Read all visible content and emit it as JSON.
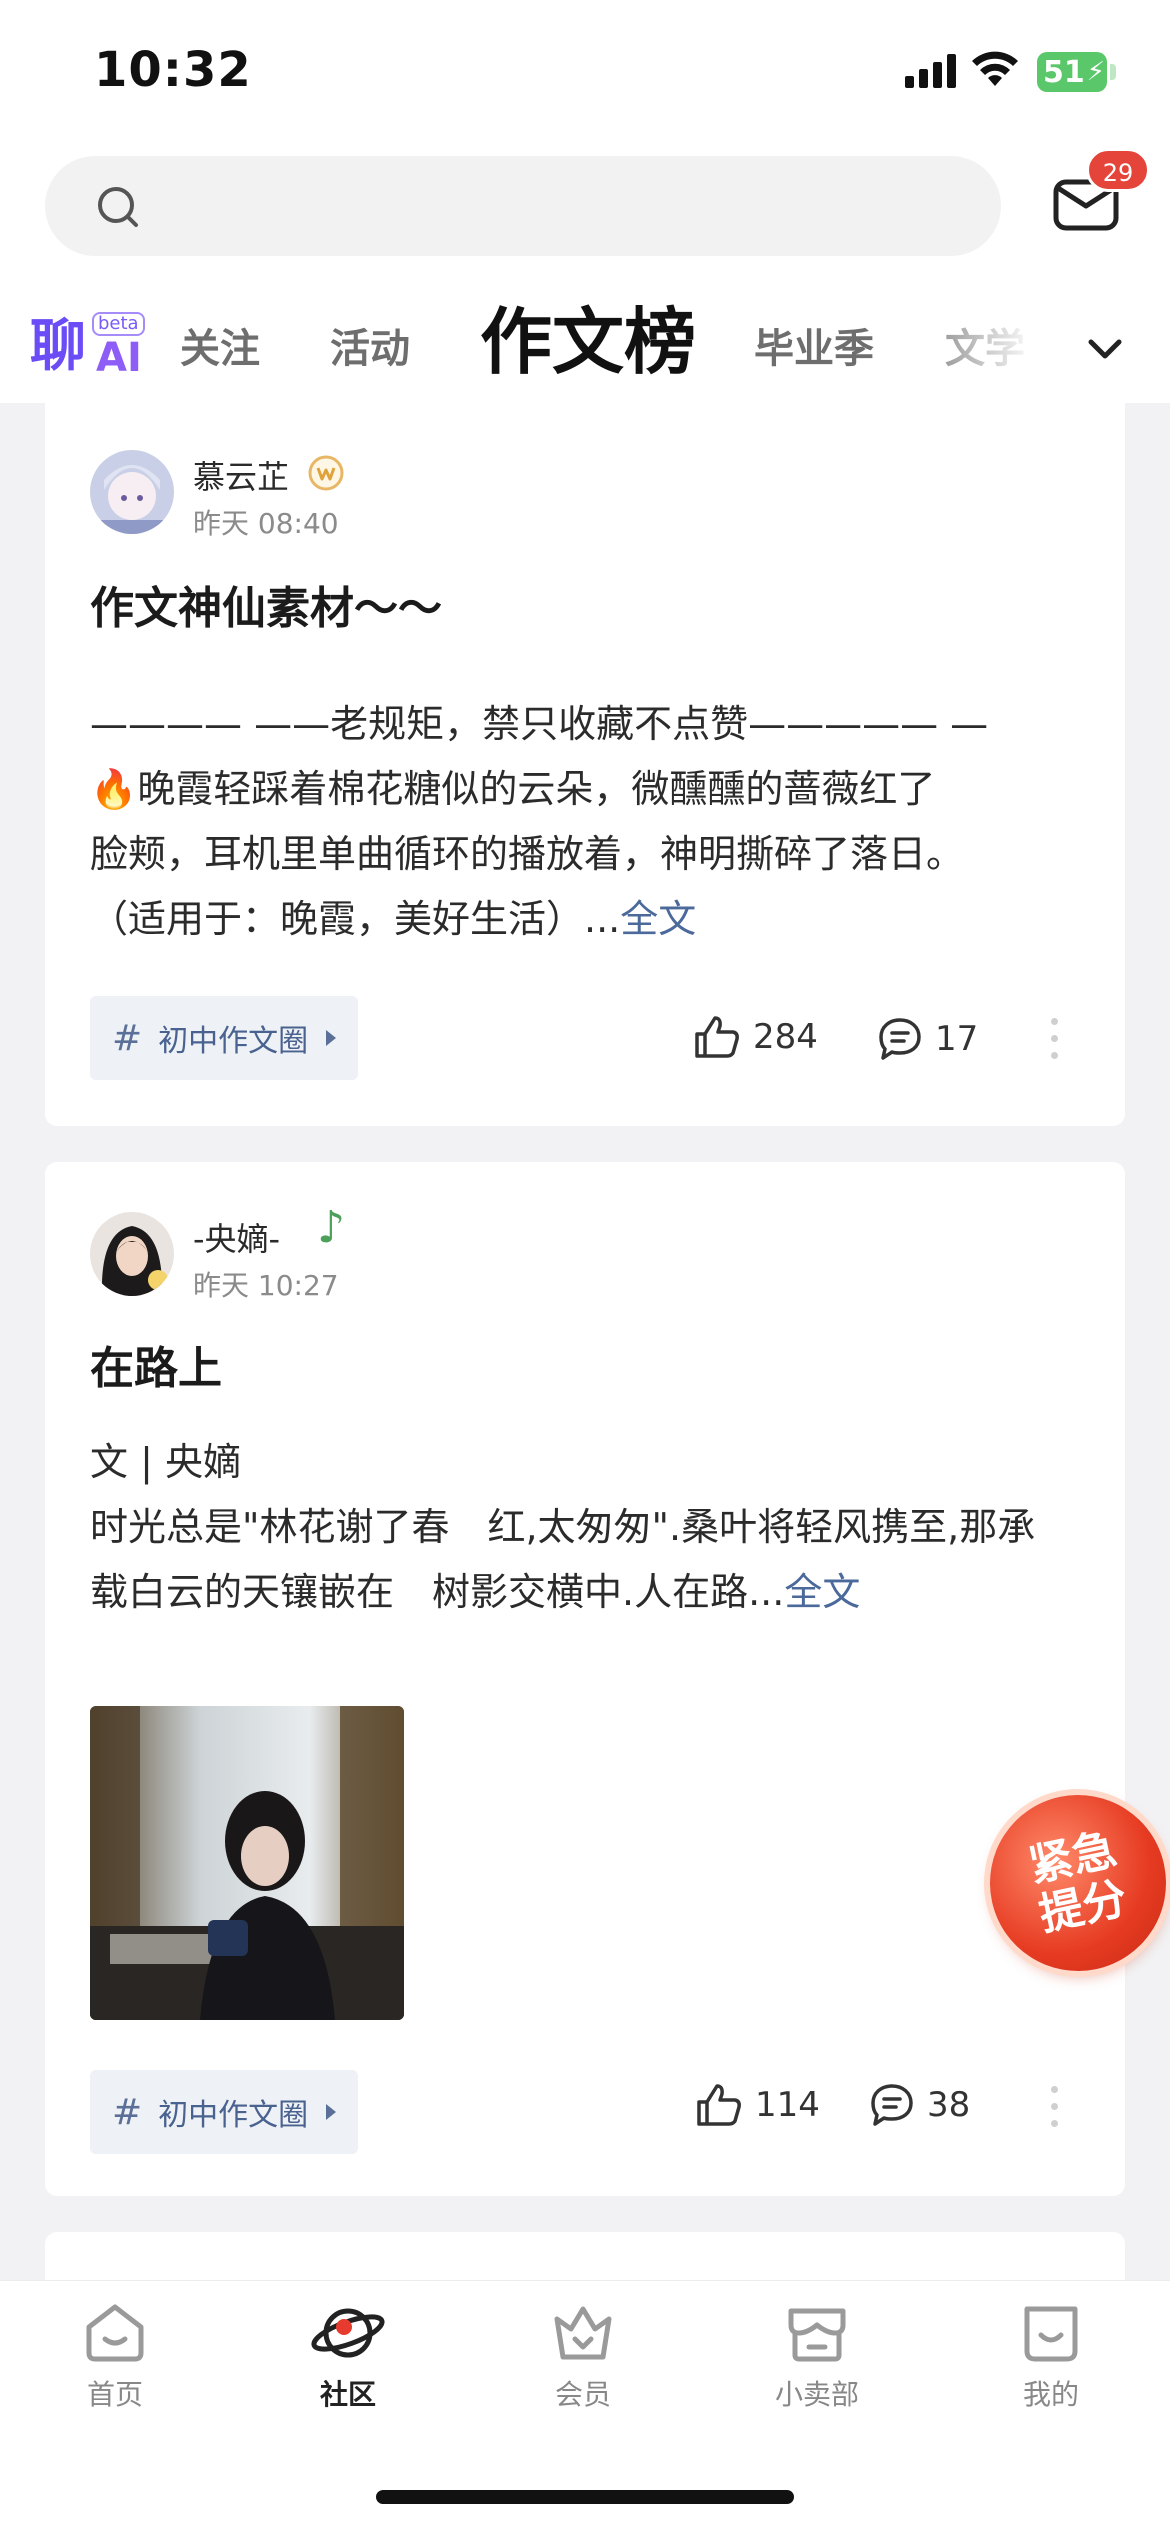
{
  "status_bar": {
    "time": "10:32",
    "battery": "51"
  },
  "search": {
    "placeholder": ""
  },
  "mail": {
    "badge_count": "29"
  },
  "tabs": {
    "ai_main": "聊",
    "ai_beta": "beta",
    "ai_suffix": "AI",
    "items": [
      {
        "label": "关注"
      },
      {
        "label": "活动"
      },
      {
        "label": "作文榜",
        "active": true
      },
      {
        "label": "毕业季"
      },
      {
        "label": "文学"
      }
    ]
  },
  "posts": [
    {
      "user": "慕云芷",
      "time": "昨天 08:40",
      "title": "作文神仙素材～～",
      "lines": [
        "———— ——老规矩，禁只收藏不点赞————— —",
        "🔥晚霞轻踩着棉花糖似的云朵，微醺醺的蔷薇红了",
        "脸颊，耳机里单曲循环的播放着，神明撕碎了落日。",
        "（适用于：晚霞，美好生活）..."
      ],
      "full_text_label": "全文",
      "topic": "初中作文圈",
      "likes": "284",
      "comments": "17"
    },
    {
      "user": "-央嫡-",
      "user_badge": "♪",
      "time": "昨天 10:27",
      "title": "在路上",
      "lines": [
        "文 | 央嫡",
        "时光总是\"林花谢了春　红,太匆匆\".桑叶将轻风携至,那承",
        "载白云的天镶嵌在　树影交横中.人在路..."
      ],
      "full_text_label": "全文",
      "topic": "初中作文圈",
      "likes": "114",
      "comments": "38"
    }
  ],
  "floating_badge": {
    "line1": "紧急",
    "line2": "提分"
  },
  "bottom_nav": [
    {
      "label": "首页",
      "icon": "home-icon"
    },
    {
      "label": "社区",
      "icon": "planet-icon",
      "active": true
    },
    {
      "label": "会员",
      "icon": "crown-icon"
    },
    {
      "label": "小卖部",
      "icon": "shop-icon"
    },
    {
      "label": "我的",
      "icon": "profile-icon"
    }
  ],
  "colors": {
    "accent_link": "#4b6a9b",
    "badge_red": "#e5443b",
    "ai_purple": "#6b4cf6",
    "battery_green": "#5ac86a"
  }
}
